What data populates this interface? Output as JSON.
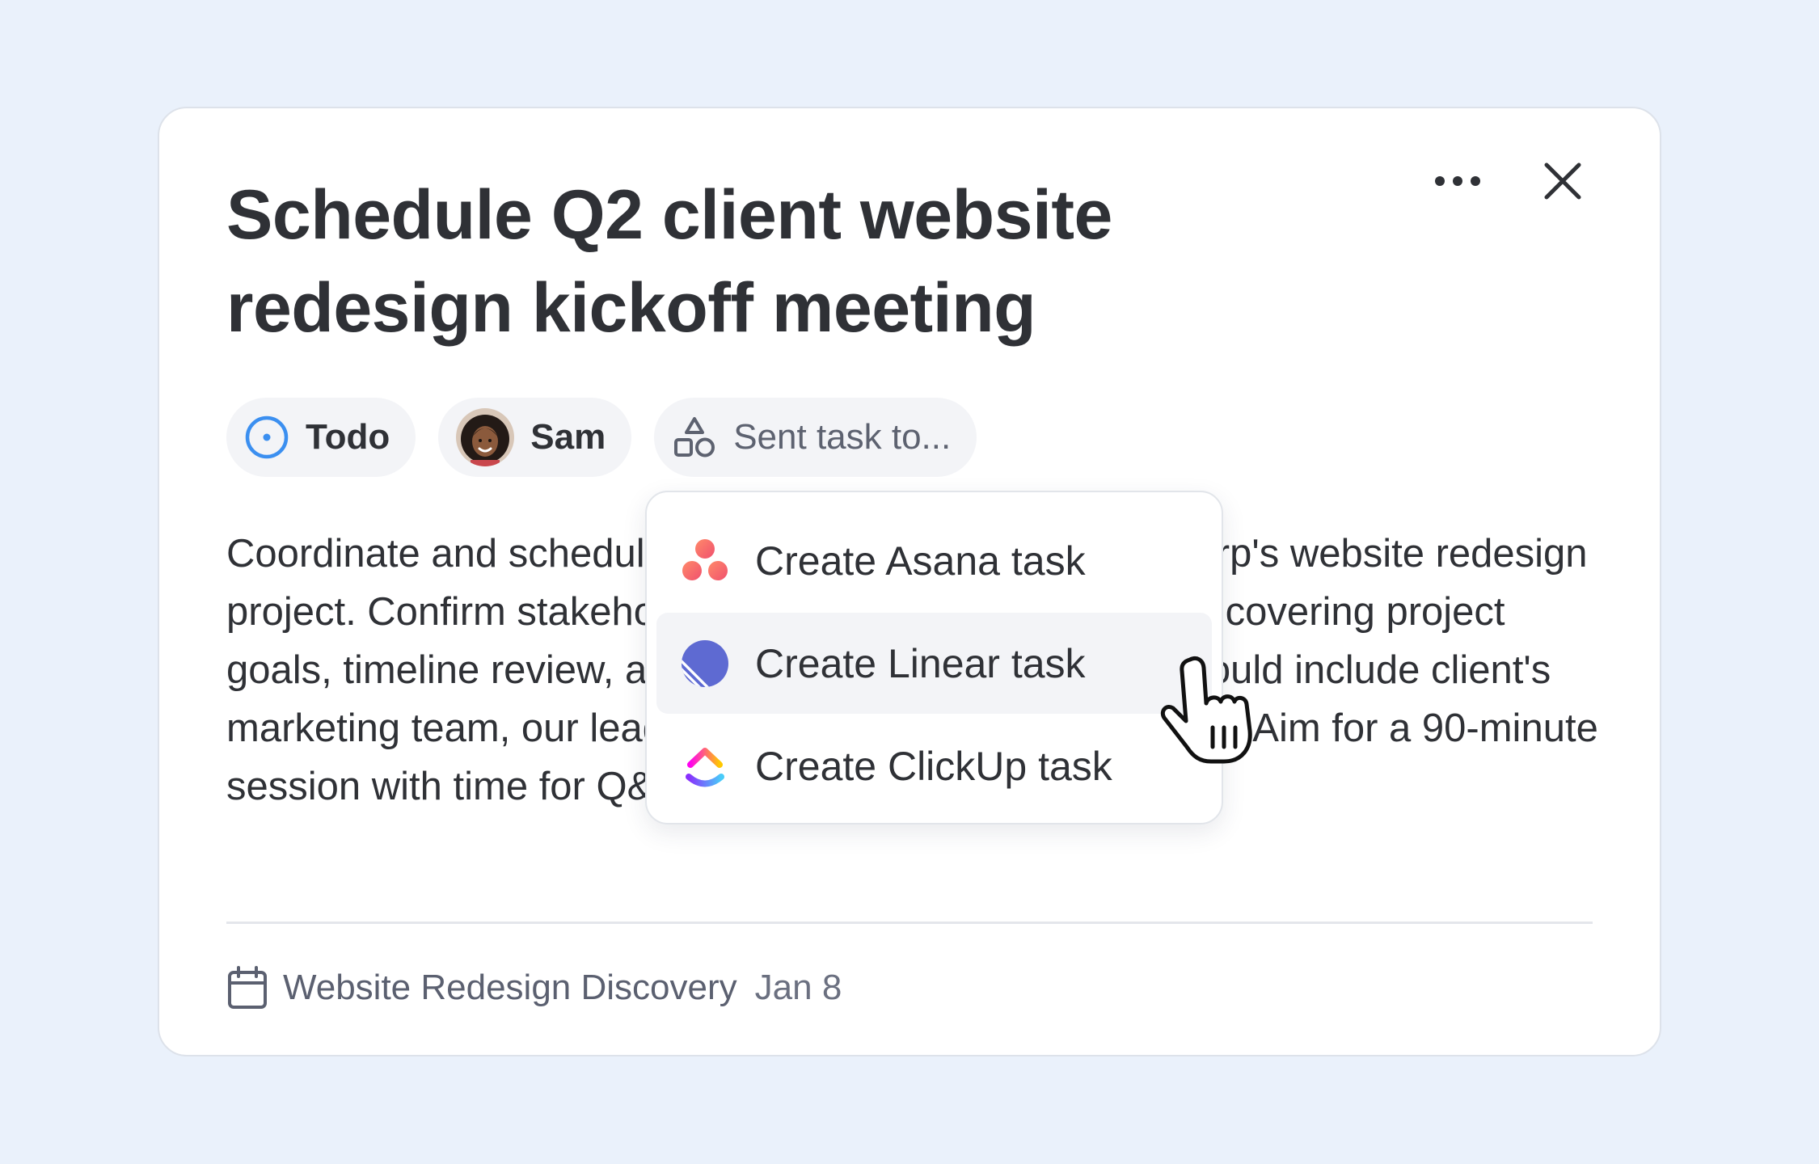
{
  "task": {
    "title": "Schedule Q2 client website redesign kickoff meeting",
    "description": "Coordinate and schedule the kickoff meeting for ABC Corp's website redesign project. Confirm stakeholder availability, prepare agenda covering project goals, timeline review, and brand guidelines. Meeting should include client's marketing team, our lead designer and technical architect. Aim for a 90-minute session with time for Q&A."
  },
  "pills": {
    "status": {
      "label": "Todo",
      "icon": "circle-dot-icon",
      "color": "#3b8ff0"
    },
    "assignee": {
      "label": "Sam",
      "icon": "avatar"
    },
    "integration": {
      "label": "Sent task to...",
      "icon": "shapes-icon"
    }
  },
  "dropdown": {
    "items": [
      {
        "label": "Create Asana task",
        "icon": "asana-icon"
      },
      {
        "label": "Create Linear task",
        "icon": "linear-icon"
      },
      {
        "label": "Create ClickUp task",
        "icon": "clickup-icon"
      }
    ]
  },
  "footer": {
    "project": "Website Redesign Discovery",
    "date": "Jan 8",
    "icon": "calendar-icon"
  },
  "colors": {
    "background": "#eaf1fb",
    "status_blue": "#3b8ff0",
    "asana": "#f06a6a",
    "linear": "#5e6ad2"
  }
}
